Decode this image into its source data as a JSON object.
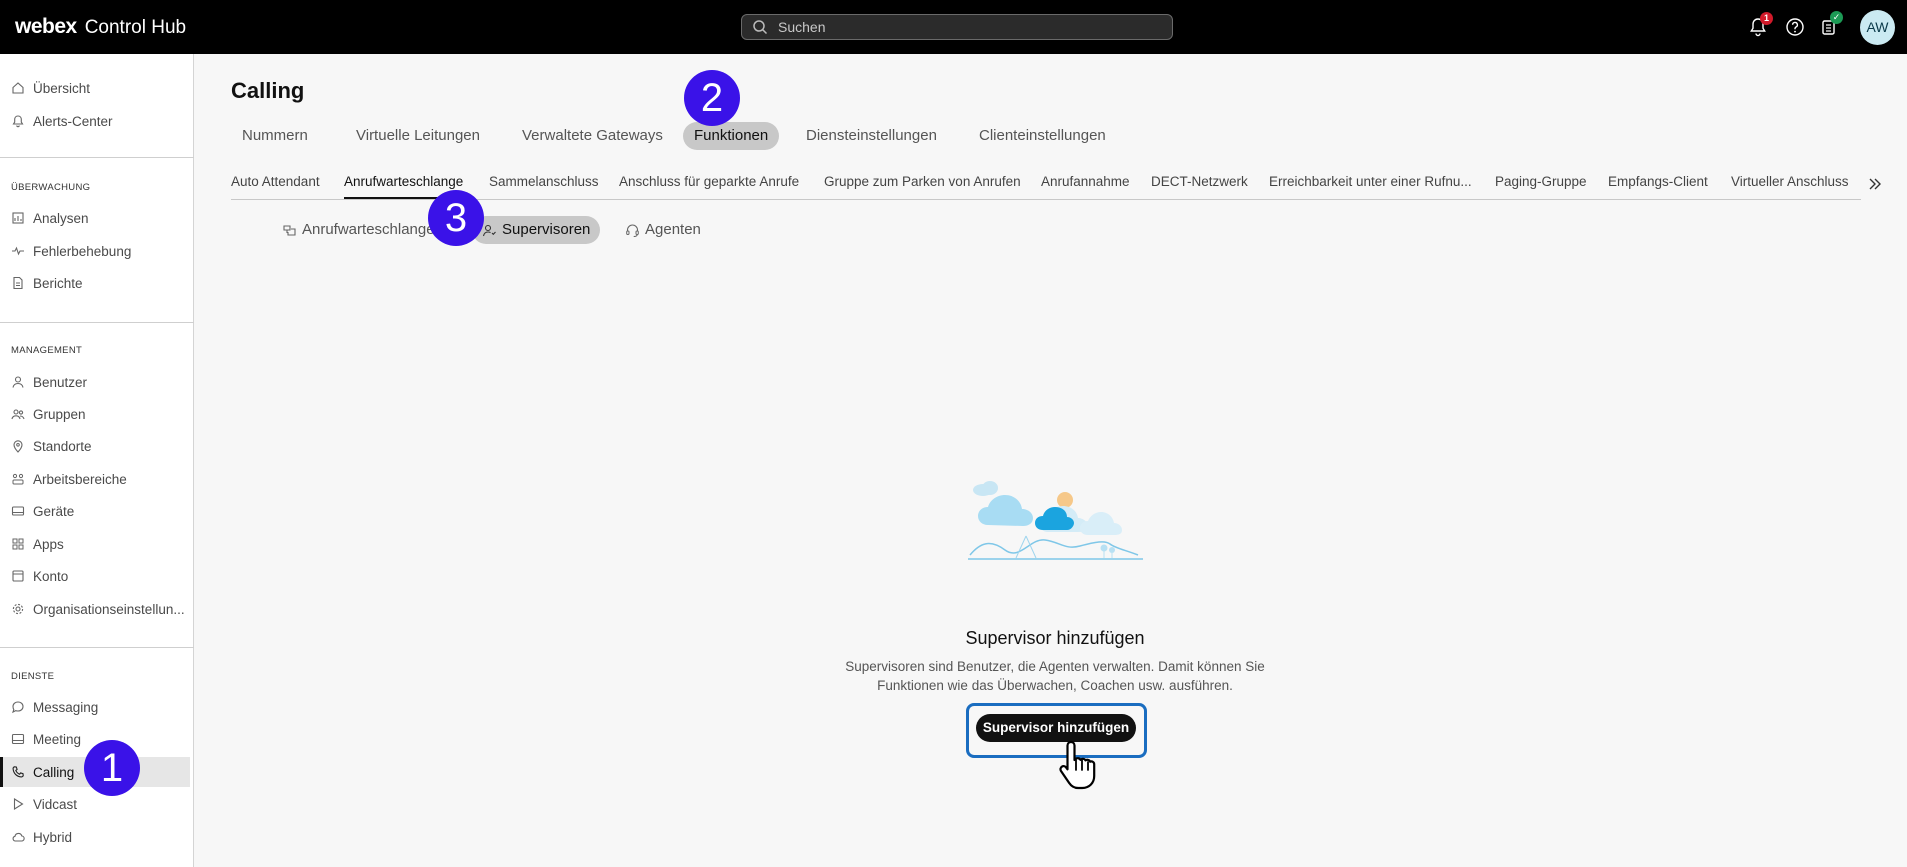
{
  "brand": {
    "logo": "webex",
    "product": "Control Hub"
  },
  "search": {
    "placeholder": "Suchen"
  },
  "header": {
    "notification_count": "1",
    "avatar_initials": "AW"
  },
  "sidebar": {
    "items_top": [
      {
        "label": "Übersicht",
        "icon": "home-icon"
      },
      {
        "label": "Alerts-Center",
        "icon": "bell-icon"
      }
    ],
    "section_monitoring": "ÜBERWACHUNG",
    "items_monitoring": [
      {
        "label": "Analysen",
        "icon": "analytics-icon"
      },
      {
        "label": "Fehlerbehebung",
        "icon": "pulse-icon"
      },
      {
        "label": "Berichte",
        "icon": "report-icon"
      }
    ],
    "section_management": "MANAGEMENT",
    "items_management": [
      {
        "label": "Benutzer",
        "icon": "user-icon"
      },
      {
        "label": "Gruppen",
        "icon": "group-icon"
      },
      {
        "label": "Standorte",
        "icon": "location-icon"
      },
      {
        "label": "Arbeitsbereiche",
        "icon": "workspace-icon"
      },
      {
        "label": "Geräte",
        "icon": "device-icon"
      },
      {
        "label": "Apps",
        "icon": "apps-icon"
      },
      {
        "label": "Konto",
        "icon": "account-icon"
      },
      {
        "label": "Organisationseinstellun...",
        "icon": "gear-icon"
      }
    ],
    "section_services": "DIENSTE",
    "items_services": [
      {
        "label": "Messaging",
        "icon": "chat-icon"
      },
      {
        "label": "Meeting",
        "icon": "meeting-icon"
      },
      {
        "label": "Calling",
        "icon": "phone-icon",
        "active": true
      },
      {
        "label": "Vidcast",
        "icon": "play-icon"
      },
      {
        "label": "Hybrid",
        "icon": "cloud-icon"
      }
    ]
  },
  "main": {
    "title": "Calling",
    "tabs": [
      "Nummern",
      "Virtuelle Leitungen",
      "Verwaltete Gateways",
      "Funktionen",
      "Diensteinstellungen",
      "Clienteinstellungen"
    ],
    "active_tab": "Funktionen",
    "feature_tabs": [
      "Auto Attendant",
      "Anrufwarteschlange",
      "Sammelanschluss",
      "Anschluss für geparkte Anrufe",
      "Gruppe zum Parken von Anrufen",
      "Anrufannahme",
      "DECT-Netzwerk",
      "Erreichbarkeit unter einer Rufnu...",
      "Paging-Gruppe",
      "Empfangs-Client",
      "Virtueller Anschluss"
    ],
    "active_feature_tab": "Anrufwarteschlange",
    "sub_tabs": [
      "Anrufwarteschlange",
      "Supervisoren",
      "Agenten"
    ],
    "active_sub_tab": "Supervisoren"
  },
  "empty_state": {
    "title": "Supervisor hinzufügen",
    "description": "Supervisoren sind Benutzer, die Agenten verwalten. Damit können Sie Funktionen wie das Überwachen, Coachen usw. ausführen.",
    "button": "Supervisor hinzufügen"
  },
  "steps": [
    "1",
    "2",
    "3"
  ],
  "colors": {
    "step_marker": "#3a12e8",
    "highlight_outline": "#1a6dc0",
    "topbar": "#000000",
    "badge_red": "#d11a2a",
    "badge_green": "#1c9a55"
  }
}
